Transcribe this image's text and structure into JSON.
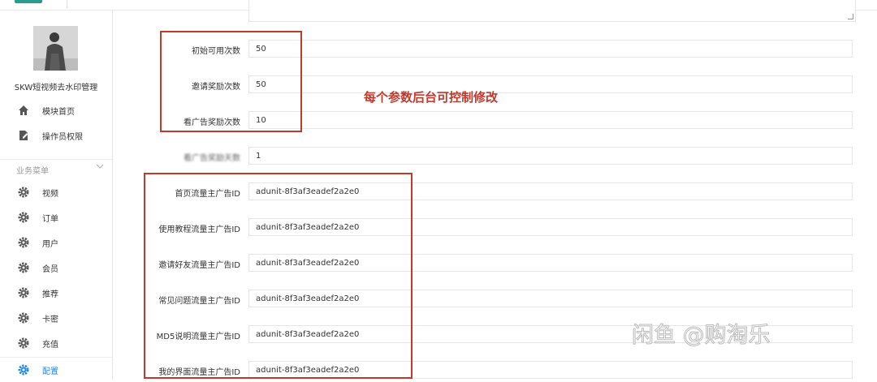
{
  "sidebar": {
    "app_title": "SKW短视频去水印管理",
    "top_items": [
      {
        "label": "模块首页",
        "icon": "home-icon"
      },
      {
        "label": "操作员权限",
        "icon": "edit-doc-icon"
      }
    ],
    "section_title": "业务菜单",
    "items": [
      {
        "label": "视频",
        "icon": "gear-icon"
      },
      {
        "label": "订单",
        "icon": "gear-icon"
      },
      {
        "label": "用户",
        "icon": "gear-icon"
      },
      {
        "label": "会员",
        "icon": "gear-icon"
      },
      {
        "label": "推荐",
        "icon": "gear-icon"
      },
      {
        "label": "卡密",
        "icon": "gear-icon"
      },
      {
        "label": "充值",
        "icon": "gear-icon"
      },
      {
        "label": "配置",
        "icon": "gear-icon",
        "active": true
      }
    ]
  },
  "form": {
    "fields": [
      {
        "label": "初始可用次数",
        "value": "50"
      },
      {
        "label": "邀请奖励次数",
        "value": "50"
      },
      {
        "label": "看广告奖励次数",
        "value": "10"
      },
      {
        "label": "看广告奖励天数",
        "value": "1"
      },
      {
        "label": "首页流量主广告ID",
        "value": "adunit-8f3af3eadef2a2e0"
      },
      {
        "label": "使用教程流量主广告ID",
        "value": "adunit-8f3af3eadef2a2e0"
      },
      {
        "label": "邀请好友流量主广告ID",
        "value": "adunit-8f3af3eadef2a2e0"
      },
      {
        "label": "常见问题流量主广告ID",
        "value": "adunit-8f3af3eadef2a2e0"
      },
      {
        "label": "MD5说明流量主广告ID",
        "value": "adunit-8f3af3eadef2a2e0"
      },
      {
        "label": "我的界面流量主广告ID",
        "value": "adunit-8f3af3eadef2a2e0"
      }
    ]
  },
  "annotation": "每个参数后台可控制修改",
  "watermark": "闲鱼 @购淘乐",
  "colors": {
    "annotation_red": "#c0392b",
    "active_blue": "#1e88e5"
  }
}
